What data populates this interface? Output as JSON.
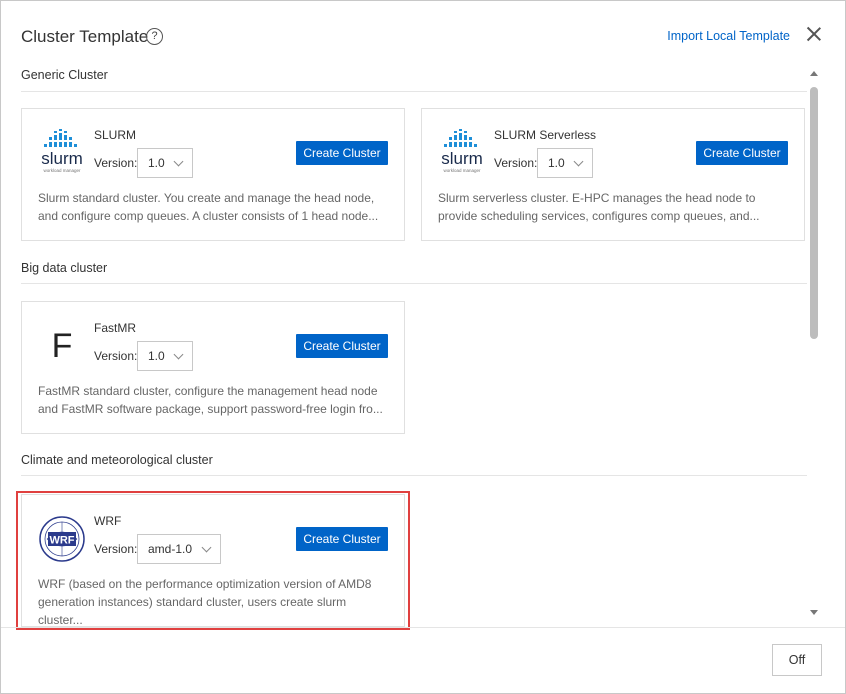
{
  "dialog": {
    "title": "Cluster Template",
    "help_icon": "question-circle-icon",
    "import_link": "Import Local Template",
    "close_icon": "close-icon"
  },
  "sections": [
    {
      "title": "Generic Cluster",
      "cards": [
        {
          "name": "SLURM",
          "logo": "slurm-logo",
          "logo_text": "slurm",
          "logo_subtext": "workload manager",
          "version_label": "Version:",
          "version": "1.0",
          "button": "Create Cluster",
          "desc_line1": "Slurm standard cluster. You create and manage the head node,",
          "desc_line2": "and configure comp queues. A cluster consists of 1 head node..."
        },
        {
          "name": "SLURM Serverless",
          "logo": "slurm-logo",
          "logo_text": "slurm",
          "logo_subtext": "workload manager",
          "version_label": "Version:",
          "version": "1.0",
          "button": "Create Cluster",
          "desc_line1": "Slurm serverless cluster. E-HPC manages the head node to",
          "desc_line2": "provide scheduling services, configures comp queues, and..."
        }
      ]
    },
    {
      "title": "Big data cluster",
      "cards": [
        {
          "name": "FastMR",
          "logo": "fastmr-logo",
          "logo_text": "F",
          "version_label": "Version:",
          "version": "1.0",
          "button": "Create Cluster",
          "desc_line1": "FastMR standard cluster, configure the management head node",
          "desc_line2": "and FastMR software package, support password-free login fro..."
        }
      ]
    },
    {
      "title": "Climate and meteorological cluster",
      "cards": [
        {
          "name": "WRF",
          "logo": "wrf-logo",
          "logo_text": "WRF",
          "version_label": "Version:",
          "version": "amd-1.0",
          "button": "Create Cluster",
          "desc_line1": "WRF (based on the performance optimization version of AMD8",
          "desc_line2": "generation instances) standard cluster, users create slurm cluster..."
        }
      ]
    }
  ],
  "footer": {
    "off_button": "Off"
  },
  "colors": {
    "primary": "#0064c8",
    "highlight": "#e0403f",
    "slurm_blue": "#1e8fd8",
    "slurm_dark": "#1a2b4c"
  }
}
